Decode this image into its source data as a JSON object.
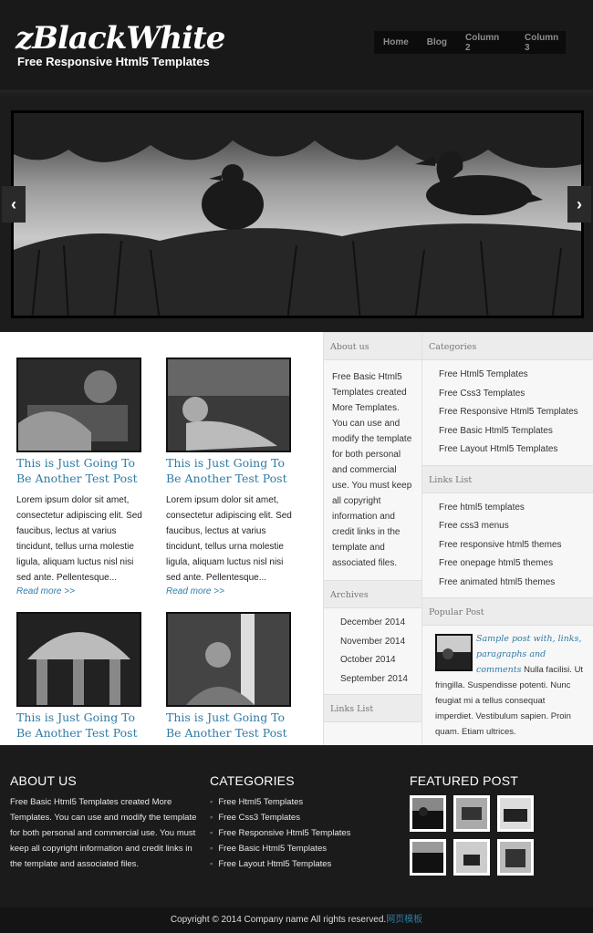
{
  "header": {
    "logo_title": "zBlackWhite",
    "logo_subtitle": "Free Responsive Html5 Templates",
    "nav": [
      "Home",
      "Blog",
      "Column 2",
      "Column 3"
    ]
  },
  "slider": {
    "prev_label": "‹",
    "next_label": "›"
  },
  "posts": [
    {
      "title": "This is Just Going To Be Another Test Post",
      "excerpt": "Lorem ipsum dolor sit amet, consectetur adipiscing elit. Sed faucibus, lectus at varius tincidunt, tellus urna molestie ligula, aliquam luctus nisl nisi sed ante. Pellentesque...",
      "more": "Read more >>"
    },
    {
      "title": "This is Just Going To Be Another Test Post",
      "excerpt": "Lorem ipsum dolor sit amet, consectetur adipiscing elit. Sed faucibus, lectus at varius tincidunt, tellus urna molestie ligula, aliquam luctus nisl nisi sed ante. Pellentesque...",
      "more": "Read more >>"
    },
    {
      "title": "This is Just Going To Be Another Test Post"
    },
    {
      "title": "This is Just Going To Be Another Test Post"
    }
  ],
  "sidebar_left": {
    "about_heading": "About us",
    "about_text": "Free Basic Html5 Templates created More Templates. You can use and modify the template for both personal and commercial use. You must keep all copyright information and credit links in the template and associated files.",
    "archives_heading": "Archives",
    "archives": [
      "December 2014",
      "November 2014",
      "October 2014",
      "September 2014"
    ],
    "links_heading": "Links List"
  },
  "sidebar_right": {
    "categories_heading": "Categories",
    "categories": [
      "Free Html5 Templates",
      "Free Css3 Templates",
      "Free Responsive Html5 Templates",
      "Free Basic Html5 Templates",
      "Free Layout Html5 Templates"
    ],
    "links_heading": "Links List",
    "links": [
      "Free html5 templates",
      "Free css3 menus",
      "Free responsive html5 themes",
      "Free onepage html5 themes",
      "Free animated html5 themes"
    ],
    "popular_heading": "Popular Post",
    "popular_title": "Sample post with, links, paragraphs and comments",
    "popular_text": "Nulla facilisi. Ut fringilla. Suspendisse potenti. Nunc feugiat mi a tellus consequat imperdiet. Vestibulum sapien. Proin quam. Etiam ultrices."
  },
  "footer": {
    "about_heading": "ABOUT US",
    "about_text": "Free Basic Html5 Templates created More Templates. You can use and modify the template for both personal and commercial use. You must keep all copyright information and credit links in the template and associated files.",
    "categories_heading": "CATEGORIES",
    "categories": [
      "Free Html5 Templates",
      "Free Css3 Templates",
      "Free Responsive Html5 Templates",
      "Free Basic Html5 Templates",
      "Free Layout Html5 Templates"
    ],
    "featured_heading": "FEATURED POST",
    "copyright": "Copyright © 2014 Company name All rights reserved.",
    "copyright_link": "网页模板"
  },
  "colors": {
    "accent": "#2f7ba6",
    "header_bg": "#191919",
    "footer_bg": "#1b1b1b"
  }
}
